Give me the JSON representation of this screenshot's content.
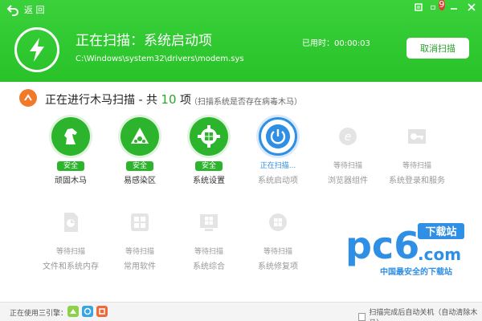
{
  "header": {
    "back_label": "返 回",
    "notif_badge": "9",
    "title": "正在扫描：系统启动项",
    "path": "C:\\Windows\\system32\\drivers\\modem.sys",
    "elapsed": "已用时：00:00:03",
    "cancel_label": "取消扫描",
    "bg_color": "#33c933"
  },
  "section": {
    "title_prefix": "正在进行木马扫描 - 共 ",
    "count": "10",
    "title_suffix": " 项",
    "hint": "（扫描系统是否存在病毒木马）"
  },
  "items": [
    {
      "name": "顽固木马",
      "status": "安全",
      "state": "done",
      "icon": "horse-icon"
    },
    {
      "name": "易感染区",
      "status": "安全",
      "state": "done",
      "icon": "infection-icon"
    },
    {
      "name": "系统设置",
      "status": "安全",
      "state": "done",
      "icon": "gear-windows-icon"
    },
    {
      "name": "系统启动项",
      "status": "正在扫描...",
      "state": "active",
      "icon": "power-icon"
    },
    {
      "name": "浏览器组件",
      "status": "等待扫描",
      "state": "wait",
      "icon": "ie-icon"
    },
    {
      "name": "系统登录和服务",
      "status": "等待扫描",
      "state": "wait",
      "icon": "key-icon"
    },
    {
      "name": "文件和系统内存",
      "status": "等待扫描",
      "state": "wait",
      "icon": "file-icon"
    },
    {
      "name": "常用软件",
      "status": "等待扫描",
      "state": "wait",
      "icon": "apps-icon"
    },
    {
      "name": "系统综合",
      "status": "等待扫描",
      "state": "wait",
      "icon": "windows-icon"
    },
    {
      "name": "系统修复项",
      "status": "等待扫描",
      "state": "wait",
      "icon": "repair-icon"
    }
  ],
  "footer": {
    "engine_label": "正在使用三引擎：",
    "autoshut_label": "扫描完成后自动关机（自动清除木马）"
  },
  "watermark": {
    "brand": "pc6",
    "dotcom": ".com",
    "tag": "下载站",
    "slogan": "中国最安全的下载站"
  }
}
